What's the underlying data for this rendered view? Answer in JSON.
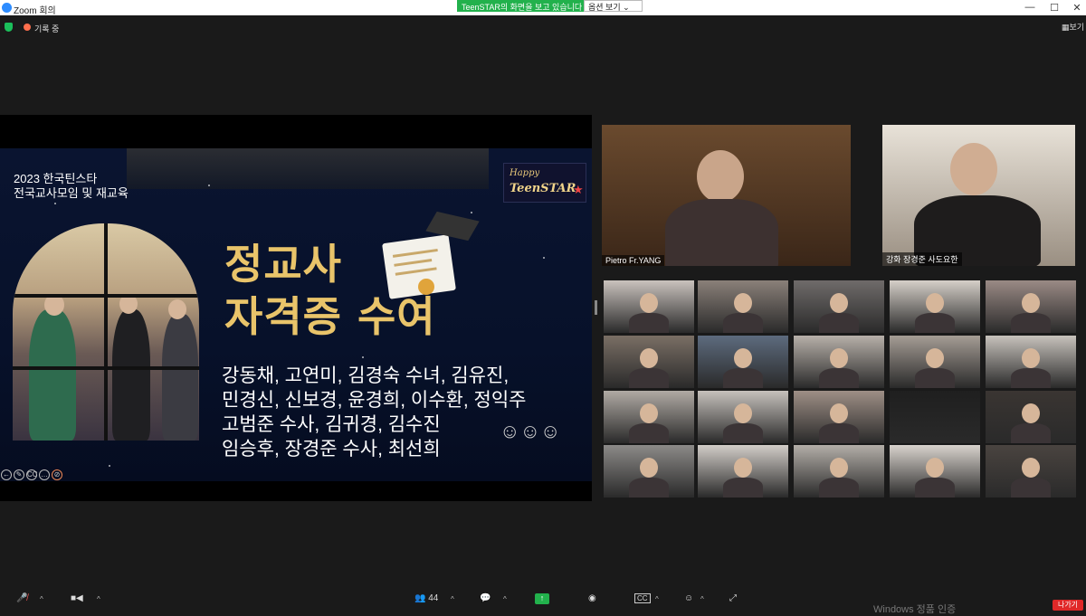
{
  "window": {
    "title": "Zoom 회의",
    "share_banner": "TeenSTAR의 화면을 보고 있습니다",
    "view_options": "옵션 보기",
    "controls": [
      "—",
      "☐",
      "✕"
    ]
  },
  "topbar": {
    "recording_label": "기록 중",
    "view_label": "보기"
  },
  "slide": {
    "subtitle_line1": "2023 한국틴스타",
    "subtitle_line2": "전국교사모임 및 재교육",
    "logo_line1": "Happy",
    "logo_line2": "TeenSTAR",
    "headline_line1": "정교사",
    "headline_line2": "자격증 수여",
    "names": [
      "강동채, 고연미, 김경숙 수녀, 김유진,",
      "민경신, 신보경, 윤경희, 이수환, 정익주",
      "고범준 수사, 김귀경, 김수진",
      "임승후, 장경준 수사, 최선희"
    ],
    "controls": [
      "←",
      "✎",
      "CC",
      "…",
      "⊘"
    ]
  },
  "video": {
    "speaker_tiles": [
      {
        "name": "Pietro Fr.YANG",
        "bg": "#5a3a25"
      },
      {
        "name": "강화 장경준 사도요한",
        "bg": "#2a2522"
      }
    ],
    "gallery_colors": [
      "#c9c2bd",
      "#8a8079",
      "#6f6b6a",
      "#d5cfc8",
      "#9a8a85",
      "#7a6f65",
      "#5d6b7e",
      "#b7b0a9",
      "#a59d95",
      "#c7c2bc",
      "#b0aaa4",
      "#c6c1bc",
      "#9e8f86",
      "#1f1f1f",
      "#3a3532",
      "#8c8a88",
      "#d2cdc8",
      "#b3aea8",
      "#d8d3cd",
      "#4a4440"
    ]
  },
  "toolbar": {
    "participants_count": "44",
    "leave_label": "나가기"
  },
  "os_watermark": "Windows 정품 인증",
  "colors": {
    "accent_green": "#22b14c",
    "headline_gold": "#e9c46a",
    "leave_red": "#e02828"
  }
}
